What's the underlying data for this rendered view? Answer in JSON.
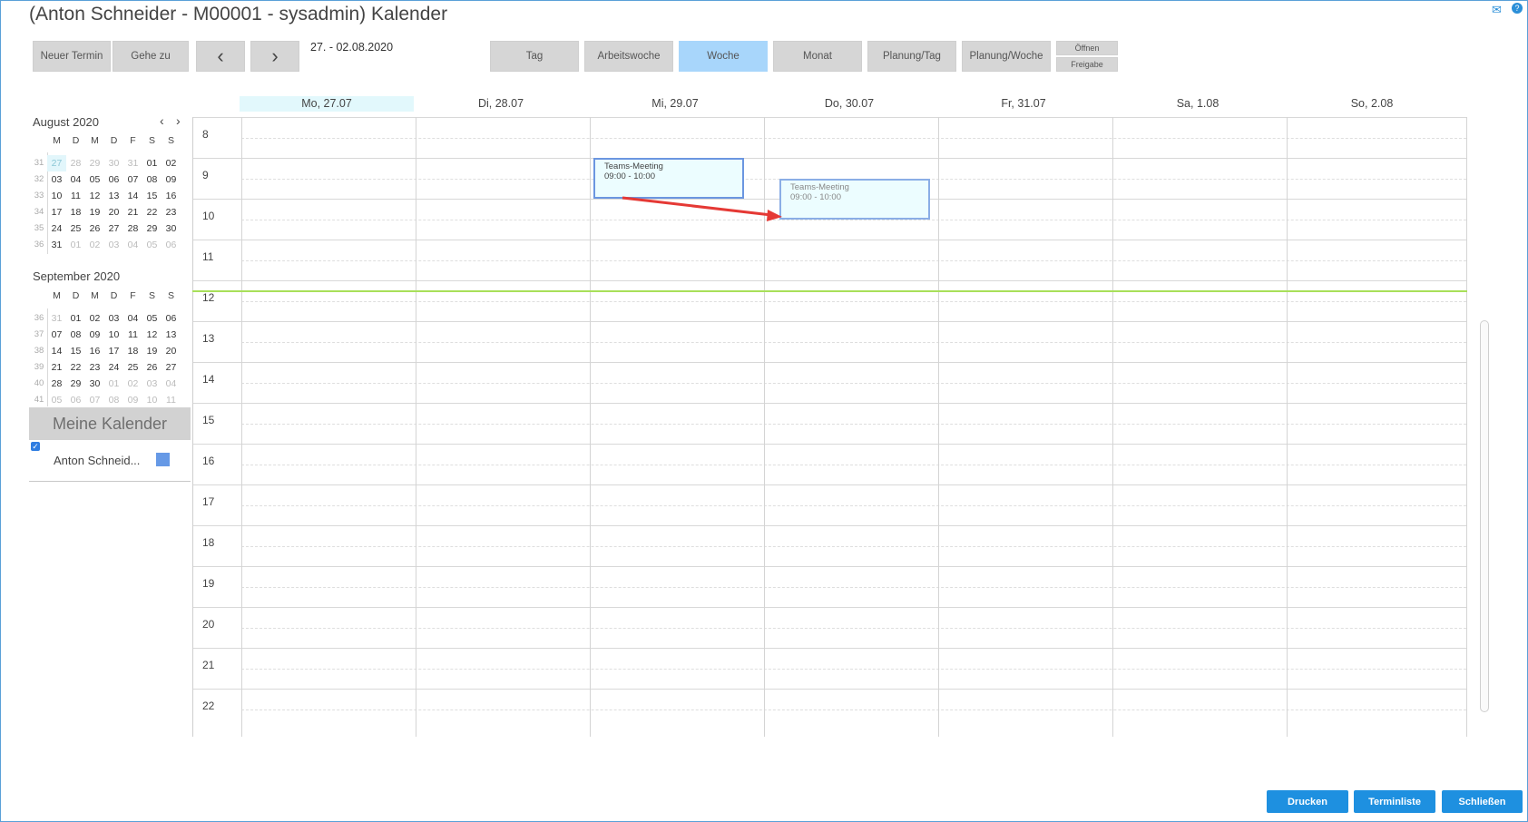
{
  "window": {
    "title": "(Anton Schneider - M00001 - sysadmin) Kalender",
    "mail_icon": "✉",
    "help_icon": "?"
  },
  "toolbar": {
    "new_appointment": "Neuer Termin",
    "goto": "Gehe zu",
    "prev": "‹",
    "next": "›",
    "range": "27. - 02.08.2020",
    "views": [
      "Tag",
      "Arbeitswoche",
      "Woche",
      "Monat",
      "Planung/Tag",
      "Planung/Woche"
    ],
    "active_view": "Woche",
    "open": "Öffnen",
    "share": "Freigabe"
  },
  "mini_calendars": [
    {
      "title": "August 2020",
      "weekdays": [
        "M",
        "D",
        "M",
        "D",
        "F",
        "S",
        "S"
      ],
      "weeks": [
        {
          "wk": "31",
          "days": [
            "27",
            "28",
            "29",
            "30",
            "31",
            "01",
            "02"
          ]
        },
        {
          "wk": "32",
          "days": [
            "03",
            "04",
            "05",
            "06",
            "07",
            "08",
            "09"
          ]
        },
        {
          "wk": "33",
          "days": [
            "10",
            "11",
            "12",
            "13",
            "14",
            "15",
            "16"
          ]
        },
        {
          "wk": "34",
          "days": [
            "17",
            "18",
            "19",
            "20",
            "21",
            "22",
            "23"
          ]
        },
        {
          "wk": "35",
          "days": [
            "24",
            "25",
            "26",
            "27",
            "28",
            "29",
            "30"
          ]
        },
        {
          "wk": "36",
          "days": [
            "31",
            "01",
            "02",
            "03",
            "04",
            "05",
            "06"
          ]
        }
      ]
    },
    {
      "title": "September 2020",
      "weekdays": [
        "M",
        "D",
        "M",
        "D",
        "F",
        "S",
        "S"
      ],
      "weeks": [
        {
          "wk": "36",
          "days": [
            "31",
            "01",
            "02",
            "03",
            "04",
            "05",
            "06"
          ]
        },
        {
          "wk": "37",
          "days": [
            "07",
            "08",
            "09",
            "10",
            "11",
            "12",
            "13"
          ]
        },
        {
          "wk": "38",
          "days": [
            "14",
            "15",
            "16",
            "17",
            "18",
            "19",
            "20"
          ]
        },
        {
          "wk": "39",
          "days": [
            "21",
            "22",
            "23",
            "24",
            "25",
            "26",
            "27"
          ]
        },
        {
          "wk": "40",
          "days": [
            "28",
            "29",
            "30",
            "01",
            "02",
            "03",
            "04"
          ]
        },
        {
          "wk": "41",
          "days": [
            "05",
            "06",
            "07",
            "08",
            "09",
            "10",
            "11"
          ]
        }
      ]
    }
  ],
  "my_calendars": {
    "title": "Meine Kalender",
    "items": [
      {
        "name": "Anton Schneid...",
        "checked": true,
        "color": "#6699e6"
      }
    ]
  },
  "week": {
    "days": [
      "Mo, 27.07",
      "Di, 28.07",
      "Mi, 29.07",
      "Do, 30.07",
      "Fr, 31.07",
      "Sa, 1.08",
      "So, 2.08"
    ],
    "hours": [
      "8",
      "9",
      "10",
      "11",
      "12",
      "13",
      "14",
      "15",
      "16",
      "17",
      "18",
      "19",
      "20",
      "21",
      "22"
    ]
  },
  "events": [
    {
      "title": "Teams-Meeting",
      "time": "09:00 - 10:00",
      "day": "Mi, 29.07"
    },
    {
      "title": "Teams-Meeting",
      "time": "09:00 - 10:00",
      "day": "Do, 30.07",
      "state": "dragged copy"
    }
  ],
  "footer": {
    "print": "Drucken",
    "list": "Terminliste",
    "close": "Schließen"
  },
  "colors": {
    "accent": "#1e90e0",
    "active_view": "#a8d6fb",
    "now_line": "#a8e05a",
    "event_border": "#6b96e0",
    "annotation_arrow": "#e53935"
  }
}
